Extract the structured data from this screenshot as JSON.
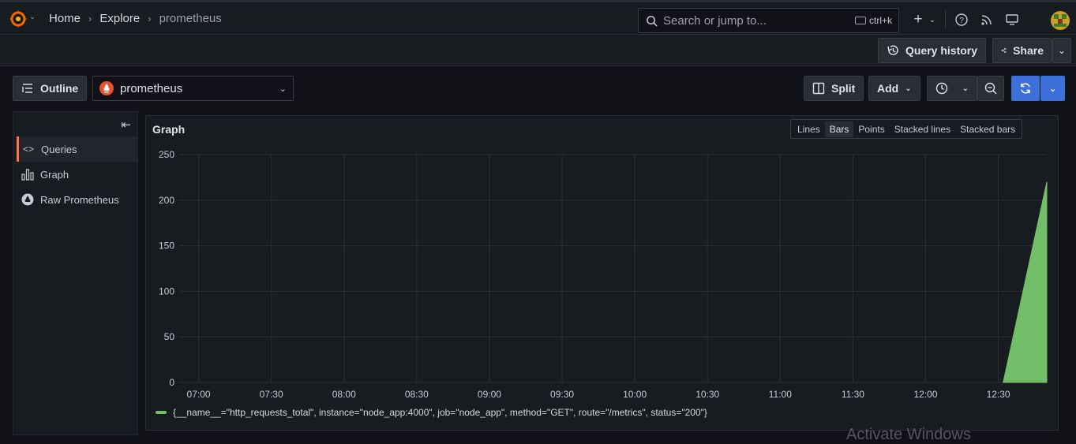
{
  "breadcrumb": {
    "home": "Home",
    "explore": "Explore",
    "current": "prometheus"
  },
  "search": {
    "placeholder": "Search or jump to...",
    "shortcut": "ctrl+k"
  },
  "subbar": {
    "query_history": "Query history",
    "share": "Share"
  },
  "toolbar": {
    "outline": "Outline",
    "datasource": "prometheus",
    "split": "Split",
    "add": "Add"
  },
  "outline": {
    "items": [
      {
        "label": "Queries",
        "icon": "code-icon"
      },
      {
        "label": "Graph",
        "icon": "graph-bar-icon"
      },
      {
        "label": "Raw Prometheus",
        "icon": "prometheus-icon"
      }
    ]
  },
  "graph": {
    "title": "Graph",
    "viz_options": [
      "Lines",
      "Bars",
      "Points",
      "Stacked lines",
      "Stacked bars"
    ],
    "selected_viz": "Bars",
    "legend": "{__name__=\"http_requests_total\", instance=\"node_app:4000\", job=\"node_app\", method=\"GET\", route=\"/metrics\", status=\"200\"}"
  },
  "chart_data": {
    "type": "area",
    "x_ticks": [
      "07:00",
      "07:30",
      "08:00",
      "08:30",
      "09:00",
      "09:30",
      "10:00",
      "10:30",
      "11:00",
      "11:30",
      "12:00",
      "12:30"
    ],
    "y_ticks": [
      0,
      50,
      100,
      150,
      200,
      250
    ],
    "ylim": [
      0,
      250
    ],
    "xlim": [
      "06:52",
      "12:50"
    ],
    "grid": true,
    "series": [
      {
        "name": "{__name__=\"http_requests_total\", instance=\"node_app:4000\", job=\"node_app\", method=\"GET\", route=\"/metrics\", status=\"200\"}",
        "color": "#73bf69",
        "points": [
          {
            "x": "12:32",
            "y": 0
          },
          {
            "x": "12:50",
            "y": 220
          }
        ]
      }
    ]
  },
  "watermark": "Activate Windows"
}
